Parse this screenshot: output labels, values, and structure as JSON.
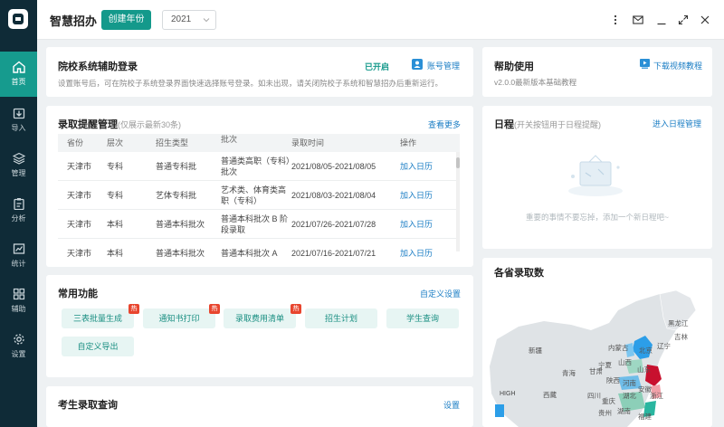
{
  "sidebar": {
    "items": [
      {
        "label": "首页",
        "icon": "home-icon",
        "active": true
      },
      {
        "label": "导入",
        "icon": "import-icon"
      },
      {
        "label": "管理",
        "icon": "layers-icon"
      },
      {
        "label": "分析",
        "icon": "clipboard-icon"
      },
      {
        "label": "统计",
        "icon": "chart-icon"
      },
      {
        "label": "辅助",
        "icon": "grid-icon"
      },
      {
        "label": "设置",
        "icon": "gear-icon"
      }
    ]
  },
  "header": {
    "title": "智慧招办",
    "create_label": "创建年份",
    "year": "2021",
    "icons": [
      "more-icon",
      "mail-icon",
      "minimize-icon",
      "maximize-icon",
      "close-icon"
    ]
  },
  "login_card": {
    "title": "院校系统辅助登录",
    "status": "已开启",
    "account_link": "账号管理",
    "desc": "设置账号后，可在院校子系统登录界面快速选择账号登录。如未出现，请关闭院校子系统和智慧招办后重新运行。"
  },
  "help_card": {
    "title": "帮助使用",
    "link": "下载视频教程",
    "version": "v2.0.0最新版本基础教程"
  },
  "admission_card": {
    "title": "录取提醒管理",
    "subtitle": "(仅展示最新30条)",
    "more_link": "查看更多",
    "columns": [
      "省份",
      "层次",
      "招生类型",
      "批次",
      "录取时间",
      "操作"
    ],
    "rows": [
      {
        "province": "天津市",
        "level": "专科",
        "type": "普通专科批",
        "batch": "普通类高职（专科）批次",
        "time": "2021/08/05-2021/08/05",
        "action": "加入日历"
      },
      {
        "province": "天津市",
        "level": "专科",
        "type": "艺体专科批",
        "batch": "艺术类、体育类高职（专科）",
        "time": "2021/08/03-2021/08/04",
        "action": "加入日历"
      },
      {
        "province": "天津市",
        "level": "本科",
        "type": "普通本科批次",
        "batch": "普通本科批次 B 阶段录取",
        "time": "2021/07/26-2021/07/28",
        "action": "加入日历"
      },
      {
        "province": "天津市",
        "level": "本科",
        "type": "普通本科批次",
        "batch": "普通本科批次 A",
        "time": "2021/07/16-2021/07/21",
        "action": "加入日历"
      }
    ]
  },
  "schedule_card": {
    "title": "日程",
    "subtitle": "(开关按钮用于日程提醒)",
    "link": "进入日程管理",
    "empty_text": "重要的事情不要忘掉，添加一个新日程吧~"
  },
  "functions_card": {
    "title": "常用功能",
    "custom_link": "自定义设置",
    "hot_label": "热",
    "buttons": [
      {
        "label": "三表批量生成",
        "hot": true
      },
      {
        "label": "通知书打印",
        "hot": true
      },
      {
        "label": "录取费用清单",
        "hot": true
      },
      {
        "label": "招生计划",
        "hot": false
      },
      {
        "label": "学生查询",
        "hot": false
      },
      {
        "label": "自定义导出",
        "hot": false
      }
    ]
  },
  "query_card": {
    "title": "考生录取查询",
    "settings_link": "设置"
  },
  "map_card": {
    "title": "各省录取数",
    "legend_high": "HIGH",
    "provinces": [
      "黑龙江",
      "吉林",
      "辽宁",
      "内蒙古",
      "北京",
      "新疆",
      "山西",
      "宁夏",
      "青海",
      "甘肃",
      "陕西",
      "山东",
      "河南",
      "西藏",
      "四川",
      "湖北",
      "浙江",
      "安徽",
      "重庆",
      "贵州",
      "湖南",
      "福建"
    ],
    "colors": {
      "high": "#c8102e",
      "mid": "#2c9ee8",
      "low": "#9ed7c3",
      "base": "#dfe3e6"
    }
  },
  "colors": {
    "accent": "#14998b",
    "sidebar": "#0f2b37",
    "link": "#1a7dc4",
    "hot": "#e8452e"
  }
}
